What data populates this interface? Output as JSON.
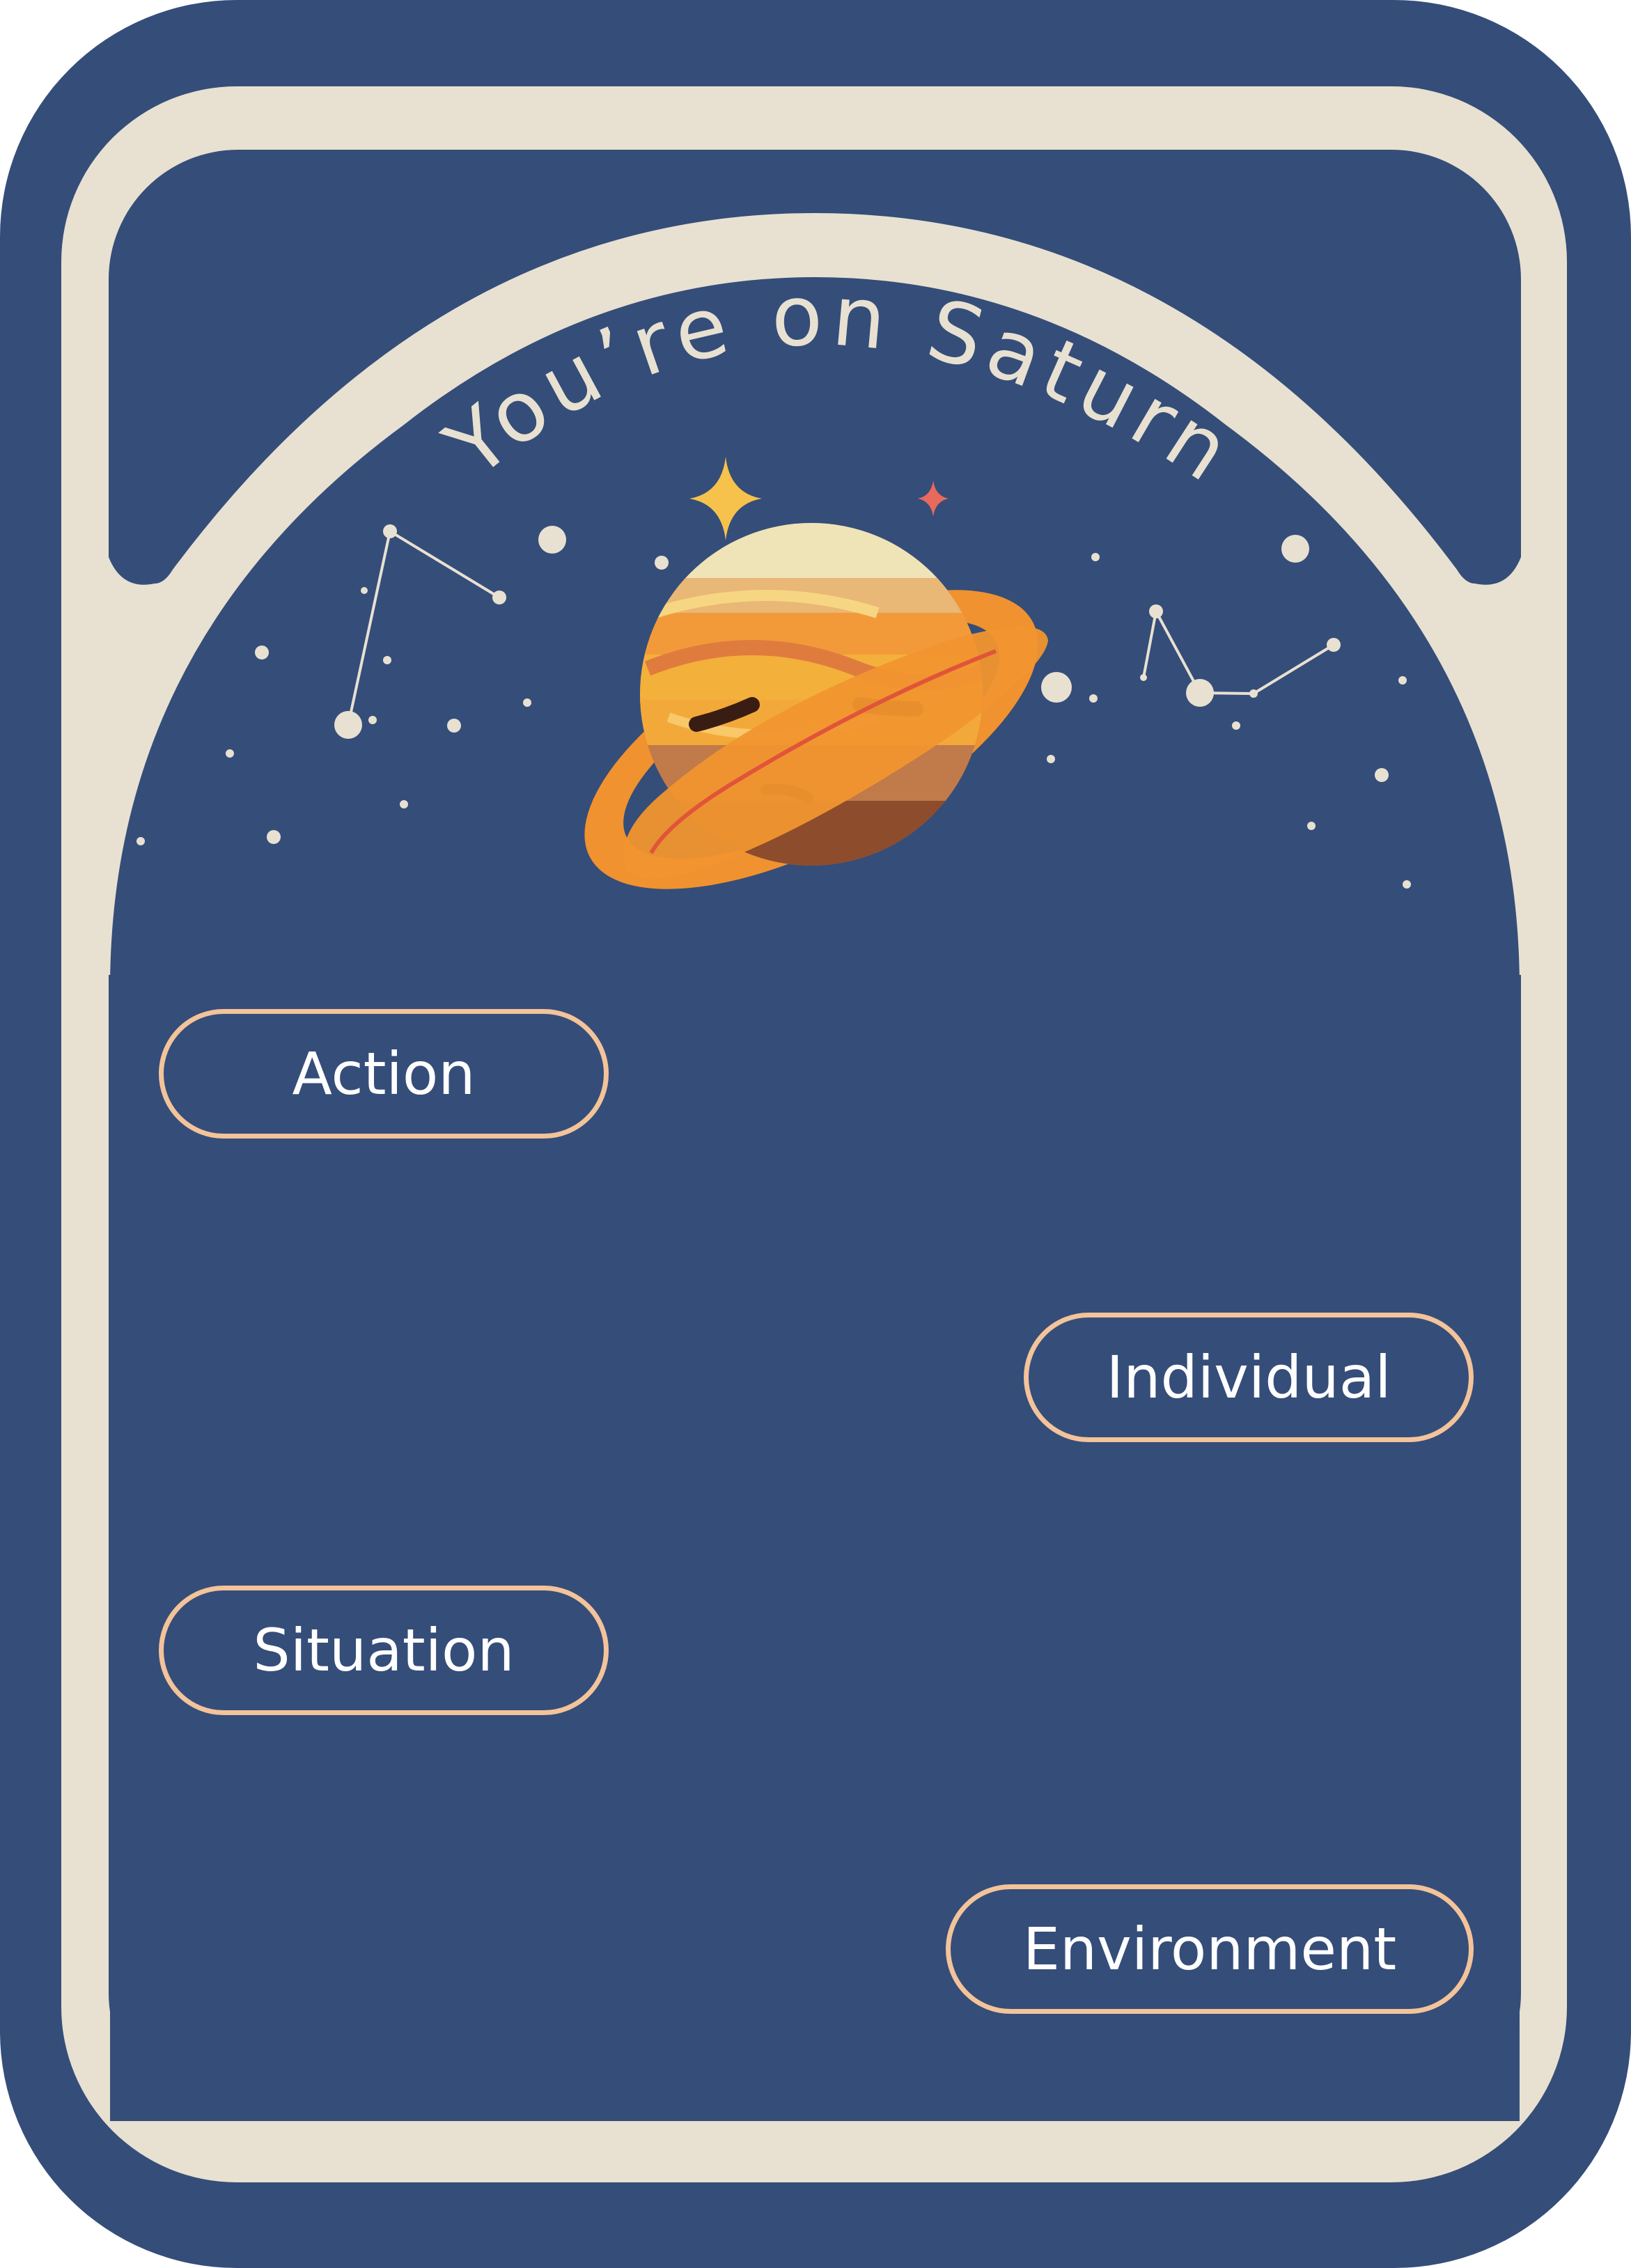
{
  "card": {
    "title": "You’re on Saturn",
    "colors": {
      "background": "#354d79",
      "frame": "#e8e1d1",
      "pill_border": "#f3c39a",
      "pill_text": "#ffffff"
    },
    "illustration_icon": "saturn-planet-character-icon",
    "options": [
      {
        "label": "Action"
      },
      {
        "label": "Individual"
      },
      {
        "label": "Situation"
      },
      {
        "label": "Environment"
      }
    ]
  }
}
